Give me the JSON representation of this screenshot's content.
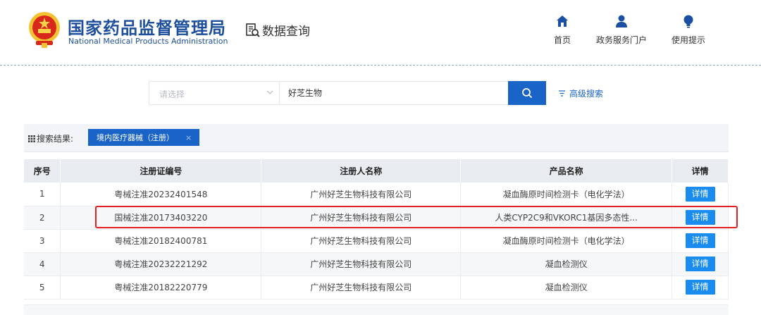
{
  "header": {
    "agency_cn": "国家药品监督管理局",
    "agency_en": "National Medical Products Administration",
    "module_label": "数据查询",
    "nav": [
      {
        "label": "首页",
        "icon": "home-icon"
      },
      {
        "label": "政务服务门户",
        "icon": "user-icon"
      },
      {
        "label": "使用提示",
        "icon": "bulb-icon"
      }
    ]
  },
  "search": {
    "category_placeholder": "请选择",
    "query_value": "好芝生物",
    "advanced_label": "高级搜索"
  },
  "results": {
    "title": "搜索结果:",
    "tag_label": "境内医疗器械（注册）",
    "tag_close": "×"
  },
  "table": {
    "headers": [
      "序号",
      "注册证编号",
      "注册人名称",
      "产品名称",
      "详情"
    ],
    "rows": [
      {
        "no": "1",
        "reg_no": "粤械注准20232401548",
        "registrant": "广州好芝生物科技有限公司",
        "product": "凝血酶原时间检测卡（电化学法）",
        "detail": "详情"
      },
      {
        "no": "2",
        "reg_no": "国械注准20173403220",
        "registrant": "广州好芝生物科技有限公司",
        "product": "人类CYP2C9和VKORC1基因多态性...",
        "detail": "详情"
      },
      {
        "no": "3",
        "reg_no": "粤械注准20182400781",
        "registrant": "广州好芝生物科技有限公司",
        "product": "凝血酶原时间检测卡（电化学法）",
        "detail": "详情"
      },
      {
        "no": "4",
        "reg_no": "粤械注准20232221292",
        "registrant": "广州好芝生物科技有限公司",
        "product": "凝血检测仪",
        "detail": "详情"
      },
      {
        "no": "5",
        "reg_no": "粤械注准20182220779",
        "registrant": "广州好芝生物科技有限公司",
        "product": "凝血检测仪",
        "detail": "详情"
      }
    ]
  },
  "colors": {
    "brand_blue": "#1d4f9c",
    "accent_blue": "#1a64c8",
    "detail_blue": "#1a8bef",
    "highlight_red": "#e32124"
  }
}
